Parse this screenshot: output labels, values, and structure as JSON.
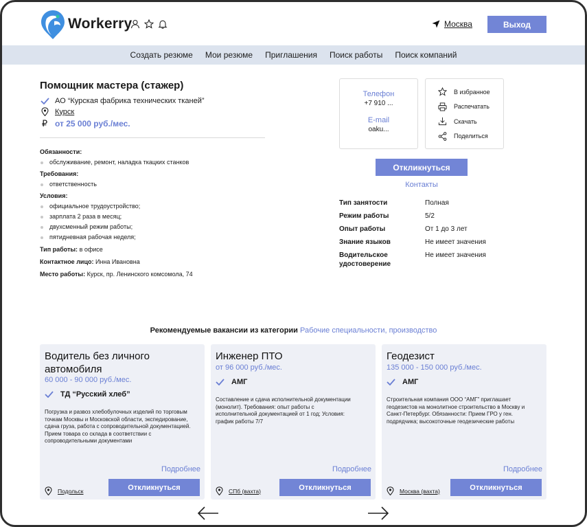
{
  "header": {
    "logo_text": "Workerry",
    "city": "Москва",
    "exit_label": "Выход"
  },
  "nav": [
    "Создать резюме",
    "Мои резюме",
    "Приглашения",
    "Поиск работы",
    "Поиск компаний"
  ],
  "vacancy": {
    "title": "Помощник мастера (стажер)",
    "company": "АО “Курская фабрика технических тканей”",
    "city": "Курск",
    "salary": "от 25 000 руб./мес.",
    "duties_h": "Обязанности:",
    "duties": [
      "обслуживание, ремонт, наладка ткацких станков"
    ],
    "req_h": "Требования:",
    "requirements": [
      "ответственность"
    ],
    "cond_h": "Условия:",
    "conditions": [
      "официальное трудоустройство;",
      "зарплата 2 раза в месяц;",
      "двухсменный режим работы;",
      "пятидневная рабочая неделя;"
    ],
    "work_type_k": "Тип работы:",
    "work_type_v": " в офисе",
    "contact_k": "Контактное лицо:",
    "contact_v": " Инна Ивановна",
    "place_k": "Место работы:",
    "place_v": " Курск, пр. Ленинского комсомола, 74"
  },
  "contacts": {
    "phone_label": "Телефон",
    "phone": "+7 910 ...",
    "email_label": "E-mail",
    "email": "oaku..."
  },
  "actions": [
    "В избранное",
    "Распечатать",
    "Скачать",
    "Поделиться"
  ],
  "respond_label": "Откликнуться",
  "contacts_link": "Контакты",
  "specs": [
    {
      "k": "Тип занятости",
      "v": "Полная"
    },
    {
      "k": "Режим работы",
      "v": "5/2"
    },
    {
      "k": "Опыт работы",
      "v": "От 1 до 3 лет"
    },
    {
      "k": "Знание языков",
      "v": "Не имеет значения"
    },
    {
      "k": "Водительское удостоверение",
      "v": "Не имеет значения"
    }
  ],
  "recommended": {
    "title": "Рекомендуемые вакансии из категории",
    "category": "Рабочие специальности, производство"
  },
  "cards": [
    {
      "title": "Водитель без личного автомобиля",
      "salary": "60 000 - 90 000 руб./мес.",
      "company": "ТД “Русский хлеб”",
      "desc": "Погрузка и развоз хлебобулочных изделий по торговым точкам Москвы и Московской области, экспедирование, сдача груза, работа с сопроводительной документацией. Прием товара со склада в соответствии с сопроводительными документами",
      "more": "Подробнее",
      "location": "Подольск",
      "button": "Откликнуться"
    },
    {
      "title": "Инженер ПТО",
      "salary": "от 96 000 руб./мес.",
      "company": "АМГ",
      "desc": "Составление и сдача исполнительной документации (монолит). Требования: опыт работы с исполнительной документацией от 1 год; Условия: график работы 7/7",
      "more": "Подробнее",
      "location": "СПб (вахта)",
      "button": "Откликнуться"
    },
    {
      "title": "Геодезист",
      "salary": "135 000 - 150 000 руб./мес.",
      "company": "АМГ",
      "desc": "Строительная компания ООО “АМГ” приглашает геодезистов на монолитное строительство в Москву и Санкт-Петербург. Обязанности: Прием ГРО у ген. подрядчика; высокоточные геодезические работы",
      "more": "Подробнее",
      "location": "Москва (вахта)",
      "button": "Откликнуться"
    }
  ],
  "colors": {
    "accent": "#7285d6",
    "nav_bg": "#dce3ee",
    "card_bg": "#eef0f6"
  }
}
